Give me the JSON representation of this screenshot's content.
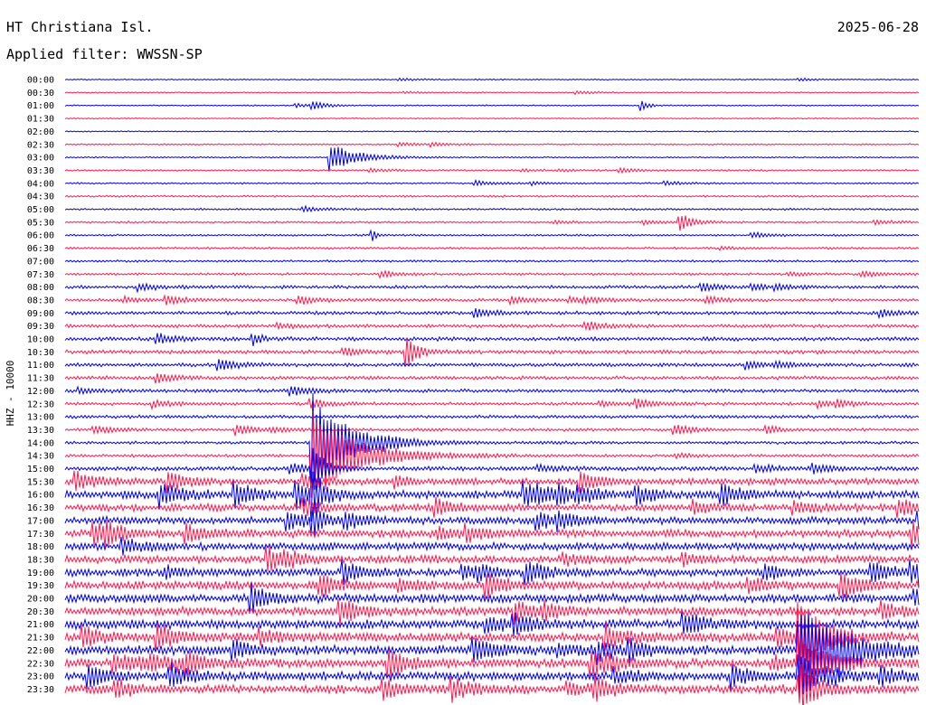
{
  "header": {
    "station": "HT Christiana Isl.",
    "date": "2025-06-28",
    "filter": "Applied filter: WWSSN-SP"
  },
  "chart_data": {
    "type": "line",
    "title": "HT Christiana Isl.",
    "ylabel": "HHZ - 10000",
    "row_labels": [
      "00:00",
      "00:30",
      "01:00",
      "01:30",
      "02:00",
      "02:30",
      "03:00",
      "03:30",
      "04:00",
      "04:30",
      "05:00",
      "05:30",
      "06:00",
      "06:30",
      "07:00",
      "07:30",
      "08:00",
      "08:30",
      "09:00",
      "09:30",
      "10:00",
      "10:30",
      "11:00",
      "11:30",
      "12:00",
      "12:30",
      "13:00",
      "13:30",
      "14:00",
      "14:30",
      "15:00",
      "15:30",
      "16:00",
      "16:30",
      "17:00",
      "17:30",
      "18:00",
      "18:30",
      "19:00",
      "19:30",
      "20:00",
      "20:30",
      "21:00",
      "21:30",
      "22:00",
      "22:30",
      "23:00",
      "23:30"
    ],
    "trace_colors": [
      "#0000e6",
      "#ff1a4f"
    ],
    "noise_levels": [
      0.5,
      0.5,
      0.5,
      0.5,
      0.5,
      0.6,
      0.6,
      0.7,
      0.7,
      0.8,
      0.8,
      0.8,
      0.8,
      0.9,
      0.9,
      1.0,
      1.3,
      1.3,
      1.4,
      1.4,
      1.6,
      1.6,
      1.5,
      1.5,
      1.4,
      1.3,
      1.3,
      1.3,
      1.2,
      1.2,
      1.8,
      2.8,
      3.4,
      3.0,
      3.0,
      3.2,
      3.2,
      3.2,
      3.3,
      3.4,
      3.6,
      3.6,
      3.8,
      3.8,
      3.8,
      3.7,
      3.6,
      3.6
    ],
    "events": [
      {
        "row": 2,
        "x": 0.29,
        "amp": 4,
        "decay": 0.015
      },
      {
        "row": 2,
        "x": 0.675,
        "amp": 6,
        "decay": 0.008
      },
      {
        "row": 6,
        "x": 0.31,
        "amp": 16,
        "decay": 0.03
      },
      {
        "row": 11,
        "x": 0.72,
        "amp": 9,
        "decay": 0.01
      },
      {
        "row": 12,
        "x": 0.36,
        "amp": 6,
        "decay": 0.005
      },
      {
        "row": 20,
        "x": 0.22,
        "amp": 7,
        "decay": 0.01
      },
      {
        "row": 21,
        "x": 0.4,
        "amp": 18,
        "decay": 0.012
      },
      {
        "row": 27,
        "x": 0.82,
        "amp": 6,
        "decay": 0.012
      },
      {
        "row": 28,
        "x": 0.29,
        "amp": 55,
        "decay": 0.04
      },
      {
        "row": 29,
        "x": 0.29,
        "amp": 50,
        "decay": 0.05
      },
      {
        "row": 30,
        "x": 0.29,
        "amp": 30,
        "decay": 0.012
      },
      {
        "row": 32,
        "x": 0.29,
        "amp": 22,
        "decay": 0.012
      },
      {
        "row": 34,
        "x": 0.29,
        "amp": 18,
        "decay": 0.012
      },
      {
        "row": 32,
        "x": 0.6,
        "amp": 9,
        "decay": 0.015
      },
      {
        "row": 38,
        "x": 0.54,
        "amp": 12,
        "decay": 0.02
      },
      {
        "row": 43,
        "x": 0.86,
        "amp": 35,
        "decay": 0.03
      },
      {
        "row": 44,
        "x": 0.86,
        "amp": 40,
        "decay": 0.05
      },
      {
        "row": 45,
        "x": 0.86,
        "amp": 28,
        "decay": 0.03
      },
      {
        "row": 46,
        "x": 0.86,
        "amp": 22,
        "decay": 0.02
      },
      {
        "row": 47,
        "x": 0.86,
        "amp": 20,
        "decay": 0.015
      }
    ]
  }
}
